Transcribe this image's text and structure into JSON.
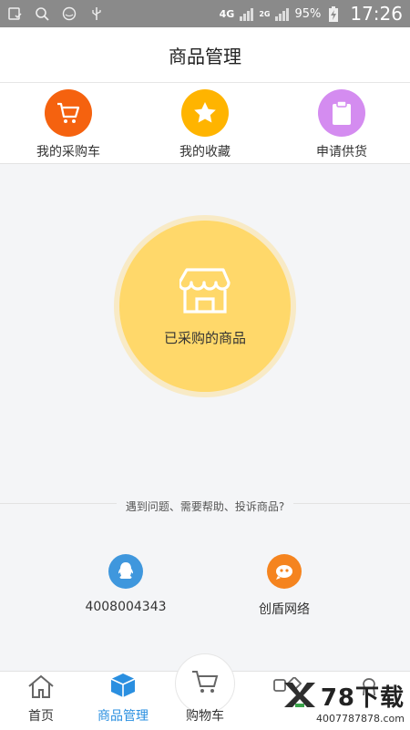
{
  "status_bar": {
    "network": "4G",
    "network_small_1": "4G",
    "network_small_2": "2G",
    "battery": "95%",
    "time": "17:26"
  },
  "header": {
    "title": "商品管理"
  },
  "quick_actions": [
    {
      "label": "我的采购车",
      "icon": "cart-icon",
      "color": "#f5620f"
    },
    {
      "label": "我的收藏",
      "icon": "star-icon",
      "color": "#ffb400"
    },
    {
      "label": "申请供货",
      "icon": "clipboard-icon",
      "color": "#d48cf0"
    }
  ],
  "main": {
    "purchased_label": "已采购的商品",
    "purchased_icon": "store-icon",
    "circle_color": "#ffd86a"
  },
  "help": {
    "text": "遇到问题、需要帮助、投诉商品?"
  },
  "contacts": [
    {
      "label": "4008004343",
      "icon": "qq-icon",
      "color": "#3f97dd"
    },
    {
      "label": "创盾网络",
      "icon": "chat-logo-icon",
      "color": "#f5841f"
    }
  ],
  "bottom_nav": [
    {
      "label": "首页",
      "icon": "home-icon"
    },
    {
      "label": "商品管理",
      "icon": "cube-icon",
      "active": true
    },
    {
      "label": "购物车",
      "icon": "cart-icon"
    },
    {
      "label": "",
      "icon": "shapes-icon"
    },
    {
      "label": "",
      "icon": "user-icon"
    }
  ],
  "watermark": {
    "text": "78下载",
    "url": "4007787878.com"
  },
  "colors": {
    "accent": "#2a8fe0"
  }
}
